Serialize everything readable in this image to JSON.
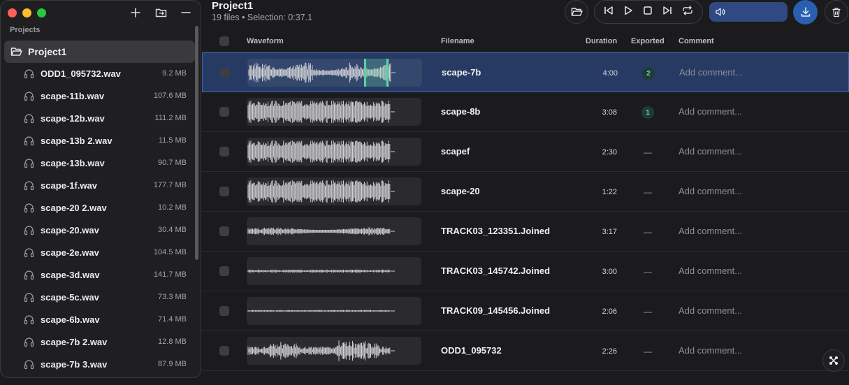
{
  "window": {
    "traffic": [
      "close",
      "minimize",
      "maximize"
    ]
  },
  "sidebar": {
    "tools": [
      {
        "icon": "plus-icon"
      },
      {
        "icon": "folder-import-icon"
      },
      {
        "icon": "minus-icon"
      }
    ],
    "section_label": "Projects",
    "project": {
      "name": "Project1"
    },
    "files": [
      {
        "name": "ODD1_095732.wav",
        "size": "9.2 MB"
      },
      {
        "name": "scape-11b.wav",
        "size": "107.6 MB"
      },
      {
        "name": "scape-12b.wav",
        "size": "111.2 MB"
      },
      {
        "name": "scape-13b 2.wav",
        "size": "11.5 MB"
      },
      {
        "name": "scape-13b.wav",
        "size": "90.7 MB"
      },
      {
        "name": "scape-1f.wav",
        "size": "177.7 MB"
      },
      {
        "name": "scape-20 2.wav",
        "size": "10.2 MB"
      },
      {
        "name": "scape-20.wav",
        "size": "30.4 MB"
      },
      {
        "name": "scape-2e.wav",
        "size": "104.5 MB"
      },
      {
        "name": "scape-3d.wav",
        "size": "141.7 MB"
      },
      {
        "name": "scape-5c.wav",
        "size": "73.3 MB"
      },
      {
        "name": "scape-6b.wav",
        "size": "71.4 MB"
      },
      {
        "name": "scape-7b 2.wav",
        "size": "12.8 MB"
      },
      {
        "name": "scape-7b 3.wav",
        "size": "87.9 MB"
      }
    ]
  },
  "header": {
    "title": "Project1",
    "subtitle": "19 files • Selection: 0:37.1"
  },
  "table": {
    "columns": {
      "waveform": "Waveform",
      "filename": "Filename",
      "duration": "Duration",
      "exported": "Exported",
      "comment": "Comment"
    },
    "rows": [
      {
        "filename": "scape-7b",
        "duration": "4:00",
        "exported": "2",
        "comment_placeholder": "Add comment...",
        "selected": true,
        "wave": "dense"
      },
      {
        "filename": "scape-8b",
        "duration": "3:08",
        "exported": "1",
        "comment_placeholder": "Add comment...",
        "wave": "full"
      },
      {
        "filename": "scapef",
        "duration": "2:30",
        "exported": "—",
        "comment_placeholder": "Add comment...",
        "wave": "full"
      },
      {
        "filename": "scape-20",
        "duration": "1:22",
        "exported": "—",
        "comment_placeholder": "Add comment...",
        "wave": "full"
      },
      {
        "filename": "TRACK03_123351.Joined",
        "duration": "3:17",
        "exported": "—",
        "comment_placeholder": "Add comment...",
        "wave": "medium"
      },
      {
        "filename": "TRACK03_145742.Joined",
        "duration": "3:00",
        "exported": "—",
        "comment_placeholder": "Add comment...",
        "wave": "thin"
      },
      {
        "filename": "TRACK09_145456.Joined",
        "duration": "2:06",
        "exported": "—",
        "comment_placeholder": "Add comment...",
        "wave": "thinnest"
      },
      {
        "filename": "ODD1_095732",
        "duration": "2:26",
        "exported": "—",
        "comment_placeholder": "Add comment...",
        "wave": "bursty"
      }
    ]
  },
  "colors": {
    "accent": "#2a5fb0",
    "selection": "#263a64",
    "export_badge": "#6fd8a9",
    "wave_selection": "#5ad3a0"
  }
}
